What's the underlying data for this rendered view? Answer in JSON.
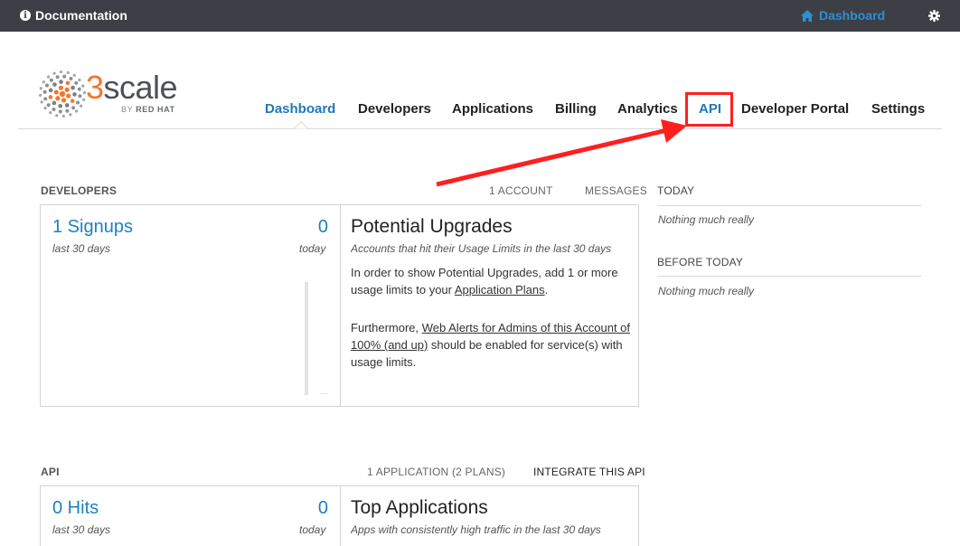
{
  "topbar": {
    "documentation_label": "Documentation",
    "dashboard_label": "Dashboard",
    "info_glyph": "i"
  },
  "logo": {
    "three": "3",
    "scale": "scale",
    "by": "BY ",
    "redhat": "RED HAT"
  },
  "nav": {
    "items": [
      "Dashboard",
      "Developers",
      "Applications",
      "Billing",
      "Analytics",
      "API",
      "Developer Portal",
      "Settings"
    ],
    "active": "Dashboard",
    "highlighted": "API"
  },
  "developers_section": {
    "title": "DEVELOPERS",
    "account_count": "1 ACCOUNT",
    "messages": "MESSAGES",
    "signups_link": "1 Signups",
    "signups_period": "last 30 days",
    "today_count": "0",
    "today_label": "today",
    "upgrades_title": "Potential Upgrades",
    "upgrades_desc": "Accounts that hit their Usage Limits in the last 30 days",
    "upgrades_p1_a": "In order to show Potential Upgrades, add 1 or more usage limits to your ",
    "upgrades_p1_link": "Application Plans",
    "upgrades_p1_b": ".",
    "upgrades_p2_a": "Furthermore, ",
    "upgrades_p2_link": "Web Alerts for Admins of this Account of 100% (and up)",
    "upgrades_p2_b": " should be enabled for service(s) with usage limits."
  },
  "activity": {
    "today_title": "TODAY",
    "today_empty": "Nothing much really",
    "before_title": "BEFORE TODAY",
    "before_empty": "Nothing much really"
  },
  "api_section": {
    "title": "API",
    "applications_count": "1 APPLICATION (2 PLANS)",
    "integrate": "INTEGRATE THIS API",
    "hits_link": "0 Hits",
    "hits_period": "last 30 days",
    "today_count": "0",
    "today_label": "today",
    "top_title": "Top Applications",
    "top_desc": "Apps with consistently high traffic in the last 30 days"
  },
  "colors": {
    "topbar": "#3c3f45",
    "link_blue": "#1f7fc2",
    "brand_orange": "#f2762e",
    "highlight_red": "#ff1f1f"
  }
}
